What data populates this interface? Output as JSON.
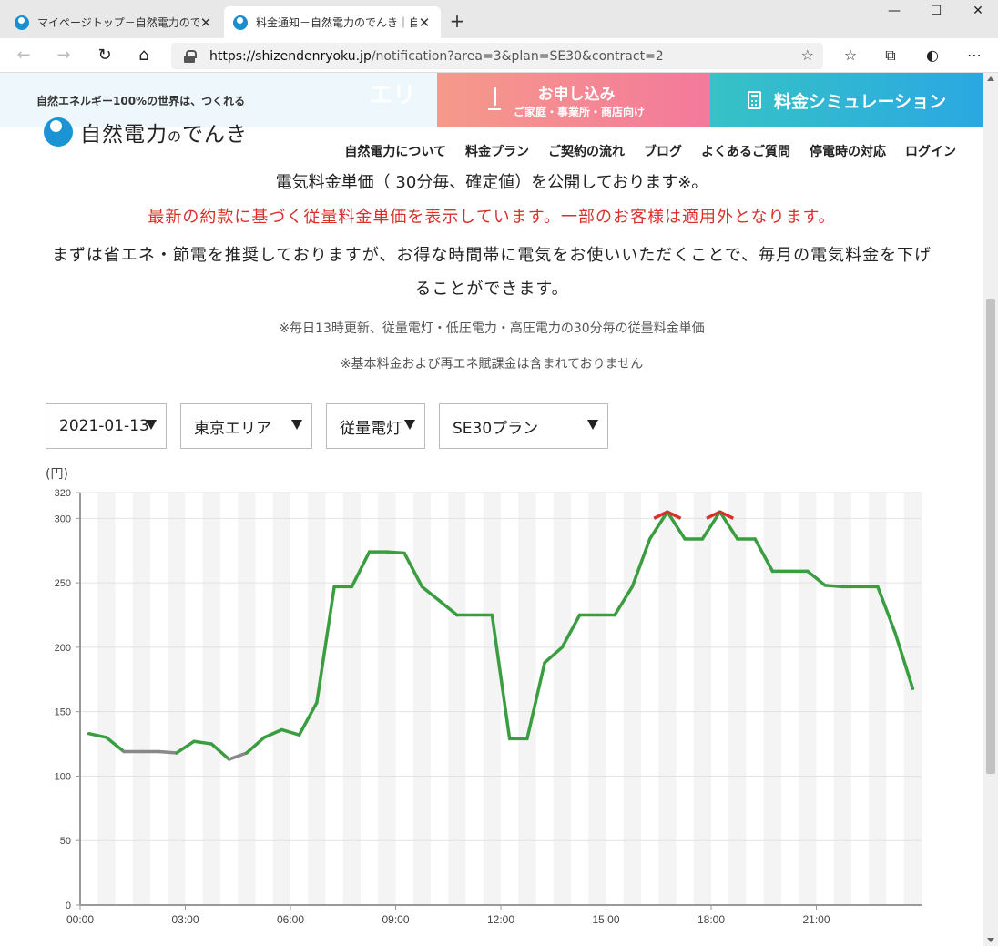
{
  "browser": {
    "tabs": [
      {
        "title": "マイページトップ－自然電力のでんき",
        "active": false
      },
      {
        "title": "料金通知－自然電力のでんき｜自",
        "active": true
      }
    ],
    "url_host": "https://shizendenryoku.jp",
    "url_path": "/notification?area=3&plan=SE30&contract=2"
  },
  "site": {
    "tagline": "自然エネルギー100%の世界は、つくれる",
    "ghost_text": "エリ",
    "apply": {
      "label": "お申し込み",
      "sub": "ご家庭・事業所・商店向け"
    },
    "simulation_label": "料金シミュレーション",
    "logo_main": "自然電力",
    "logo_no": "の",
    "logo_tail": "でんき",
    "nav": [
      "自然電力について",
      "料金プラン",
      "ご契約の流れ",
      "ブログ",
      "よくあるご質問",
      "停電時の対応",
      "ログイン"
    ]
  },
  "content": {
    "line1": "電気料金単価（ 30分毎、確定値）を公開しております※。",
    "line2": "最新の約款に基づく従量料金単価を表示しています。一部のお客様は適用外となります。",
    "line3": "まずは省エネ・節電を推奨しておりますが、お得な時間帯に電気をお使いいただくことで、毎月の電気料金を下げることができます。",
    "note1": "※毎日13時更新、従量電灯・低圧電力・高圧電力の30分毎の従量料金単価",
    "note2": "※基本料金および再エネ賦課金は含まれておりません"
  },
  "filters": {
    "date": "2021-01-13",
    "area": "東京エリア",
    "contract": "従量電灯",
    "plan": "SE30プラン"
  },
  "colors": {
    "line_normal": "#3a9e40",
    "line_low": "#888888",
    "line_peak": "#d9302b",
    "stripe": "#f4f4f4",
    "accent_red": "#d9302b"
  },
  "chart_data": {
    "type": "line",
    "unit_label": "(円)",
    "ylim": [
      0,
      320
    ],
    "yticks": [
      0,
      50,
      100,
      150,
      200,
      250,
      300,
      320
    ],
    "xticks": [
      "00:00",
      "03:00",
      "06:00",
      "09:00",
      "12:00",
      "15:00",
      "18:00",
      "21:00"
    ],
    "x": [
      "00:00",
      "00:30",
      "01:00",
      "01:30",
      "02:00",
      "02:30",
      "03:00",
      "03:30",
      "04:00",
      "04:30",
      "05:00",
      "05:30",
      "06:00",
      "06:30",
      "07:00",
      "07:30",
      "08:00",
      "08:30",
      "09:00",
      "09:30",
      "10:00",
      "10:30",
      "11:00",
      "11:30",
      "12:00",
      "12:30",
      "13:00",
      "13:30",
      "14:00",
      "14:30",
      "15:00",
      "15:30",
      "16:00",
      "16:30",
      "17:00",
      "17:30",
      "18:00",
      "18:30",
      "19:00",
      "19:30",
      "20:00",
      "20:30",
      "21:00",
      "21:30",
      "22:00",
      "22:30",
      "23:00",
      "23:30"
    ],
    "values": [
      133,
      130,
      119,
      119,
      119,
      118,
      127,
      125,
      113,
      118,
      130,
      136,
      132,
      157,
      247,
      247,
      274,
      274,
      273,
      247,
      236,
      225,
      225,
      225,
      129,
      129,
      188,
      200,
      225,
      225,
      225,
      247,
      284,
      305,
      284,
      284,
      305,
      284,
      284,
      259,
      259,
      259,
      248,
      247,
      247,
      247,
      211,
      168
    ],
    "low_threshold": 120,
    "peak_threshold": 300,
    "grid": true,
    "striped_background": true
  }
}
